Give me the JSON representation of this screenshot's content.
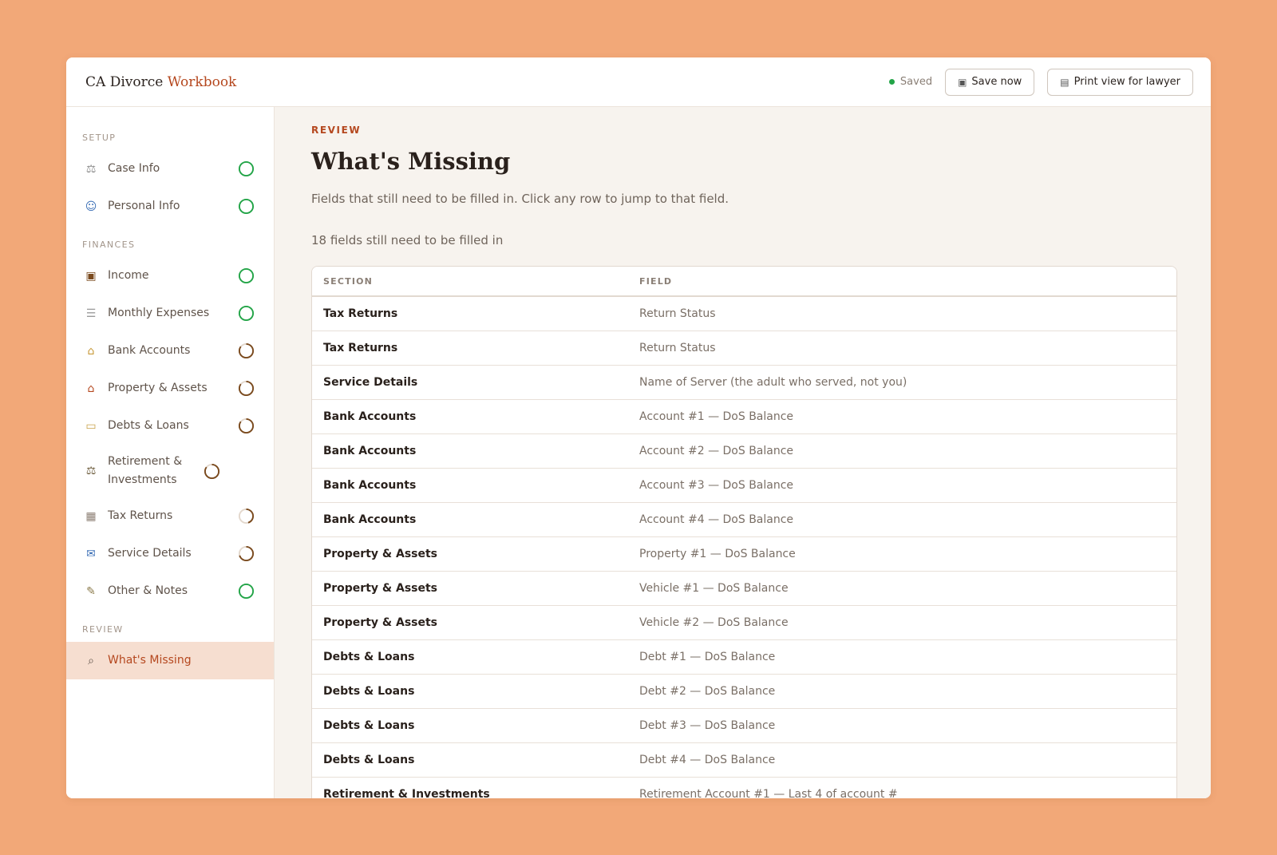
{
  "app": {
    "brand_prefix": "CA Divorce",
    "brand_accent": "Workbook",
    "saved_label": "Saved",
    "save_now_label": "Save now",
    "print_label": "Print view for lawyer"
  },
  "colors": {
    "background": "#F2A878",
    "accent": "#B5481F",
    "complete": "#22a447",
    "partial": "#7a4a1e",
    "active_bg": "#F6DED0"
  },
  "sidebar": {
    "setup_label": "SETUP",
    "finances_label": "FINANCES",
    "review_label": "REVIEW",
    "setup_items": [
      {
        "label": "Case Info",
        "icon": "scales-icon",
        "status": "complete",
        "progress": 1.0
      },
      {
        "label": "Personal Info",
        "icon": "person-icon",
        "status": "complete",
        "progress": 1.0
      }
    ],
    "finance_items": [
      {
        "label": "Income",
        "icon": "briefcase-icon",
        "status": "complete",
        "progress": 1.0
      },
      {
        "label": "Monthly Expenses",
        "icon": "receipt-icon",
        "status": "complete",
        "progress": 1.0
      },
      {
        "label": "Bank Accounts",
        "icon": "bank-icon",
        "status": "partial",
        "progress": 0.85
      },
      {
        "label": "Property & Assets",
        "icon": "house-icon",
        "status": "partial",
        "progress": 0.85
      },
      {
        "label": "Debts & Loans",
        "icon": "credit-card-icon",
        "status": "partial",
        "progress": 0.85
      },
      {
        "label": "Retirement & Investments",
        "icon": "classical-building-icon",
        "status": "partial",
        "progress": 0.85
      },
      {
        "label": "Tax Returns",
        "icon": "calendar-icon",
        "status": "partial",
        "progress": 0.45
      },
      {
        "label": "Service Details",
        "icon": "mailbox-icon",
        "status": "partial",
        "progress": 0.7
      },
      {
        "label": "Other & Notes",
        "icon": "memo-icon",
        "status": "complete",
        "progress": 1.0
      }
    ],
    "review_items": [
      {
        "label": "What's Missing",
        "icon": "magnifier-icon",
        "active": true
      }
    ]
  },
  "main": {
    "kicker": "REVIEW",
    "title": "What's Missing",
    "subtitle": "Fields that still need to be filled in. Click any row to jump to that field.",
    "count_text": "18 fields still need to be filled in",
    "columns": [
      "SECTION",
      "FIELD"
    ],
    "rows": [
      {
        "section": "Tax Returns",
        "field": "Return Status"
      },
      {
        "section": "Tax Returns",
        "field": "Return Status"
      },
      {
        "section": "Service Details",
        "field": "Name of Server (the adult who served, not you)"
      },
      {
        "section": "Bank Accounts",
        "field": "Account #1 — DoS Balance"
      },
      {
        "section": "Bank Accounts",
        "field": "Account #2 — DoS Balance"
      },
      {
        "section": "Bank Accounts",
        "field": "Account #3 — DoS Balance"
      },
      {
        "section": "Bank Accounts",
        "field": "Account #4 — DoS Balance"
      },
      {
        "section": "Property & Assets",
        "field": "Property #1 — DoS Balance"
      },
      {
        "section": "Property & Assets",
        "field": "Vehicle #1 — DoS Balance"
      },
      {
        "section": "Property & Assets",
        "field": "Vehicle #2 — DoS Balance"
      },
      {
        "section": "Debts & Loans",
        "field": "Debt #1 — DoS Balance"
      },
      {
        "section": "Debts & Loans",
        "field": "Debt #2 — DoS Balance"
      },
      {
        "section": "Debts & Loans",
        "field": "Debt #3 — DoS Balance"
      },
      {
        "section": "Debts & Loans",
        "field": "Debt #4 — DoS Balance"
      },
      {
        "section": "Retirement & Investments",
        "field": "Retirement Account #1 — Last 4 of account #"
      }
    ]
  }
}
